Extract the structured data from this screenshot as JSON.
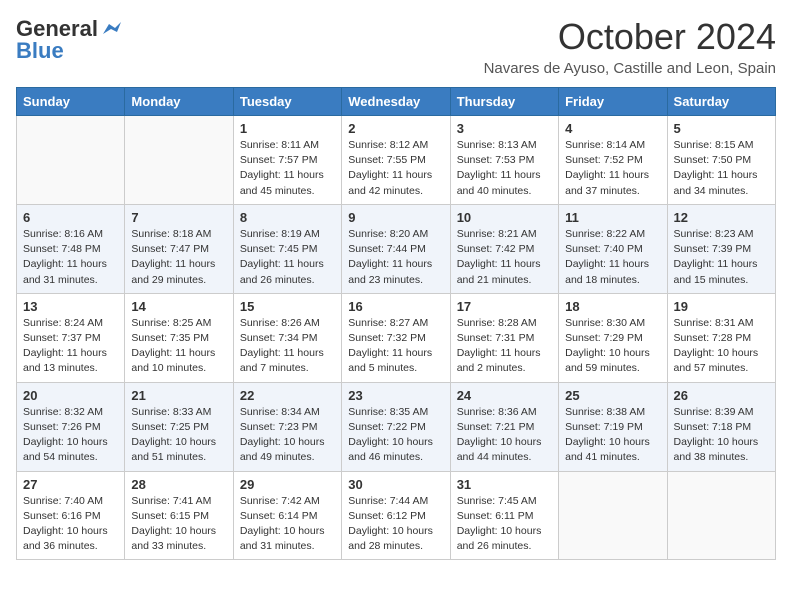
{
  "header": {
    "logo_general": "General",
    "logo_blue": "Blue",
    "month_title": "October 2024",
    "subtitle": "Navares de Ayuso, Castille and Leon, Spain"
  },
  "days_of_week": [
    "Sunday",
    "Monday",
    "Tuesday",
    "Wednesday",
    "Thursday",
    "Friday",
    "Saturday"
  ],
  "weeks": [
    [
      {
        "day": "",
        "info": ""
      },
      {
        "day": "",
        "info": ""
      },
      {
        "day": "1",
        "info": "Sunrise: 8:11 AM\nSunset: 7:57 PM\nDaylight: 11 hours and 45 minutes."
      },
      {
        "day": "2",
        "info": "Sunrise: 8:12 AM\nSunset: 7:55 PM\nDaylight: 11 hours and 42 minutes."
      },
      {
        "day": "3",
        "info": "Sunrise: 8:13 AM\nSunset: 7:53 PM\nDaylight: 11 hours and 40 minutes."
      },
      {
        "day": "4",
        "info": "Sunrise: 8:14 AM\nSunset: 7:52 PM\nDaylight: 11 hours and 37 minutes."
      },
      {
        "day": "5",
        "info": "Sunrise: 8:15 AM\nSunset: 7:50 PM\nDaylight: 11 hours and 34 minutes."
      }
    ],
    [
      {
        "day": "6",
        "info": "Sunrise: 8:16 AM\nSunset: 7:48 PM\nDaylight: 11 hours and 31 minutes."
      },
      {
        "day": "7",
        "info": "Sunrise: 8:18 AM\nSunset: 7:47 PM\nDaylight: 11 hours and 29 minutes."
      },
      {
        "day": "8",
        "info": "Sunrise: 8:19 AM\nSunset: 7:45 PM\nDaylight: 11 hours and 26 minutes."
      },
      {
        "day": "9",
        "info": "Sunrise: 8:20 AM\nSunset: 7:44 PM\nDaylight: 11 hours and 23 minutes."
      },
      {
        "day": "10",
        "info": "Sunrise: 8:21 AM\nSunset: 7:42 PM\nDaylight: 11 hours and 21 minutes."
      },
      {
        "day": "11",
        "info": "Sunrise: 8:22 AM\nSunset: 7:40 PM\nDaylight: 11 hours and 18 minutes."
      },
      {
        "day": "12",
        "info": "Sunrise: 8:23 AM\nSunset: 7:39 PM\nDaylight: 11 hours and 15 minutes."
      }
    ],
    [
      {
        "day": "13",
        "info": "Sunrise: 8:24 AM\nSunset: 7:37 PM\nDaylight: 11 hours and 13 minutes."
      },
      {
        "day": "14",
        "info": "Sunrise: 8:25 AM\nSunset: 7:35 PM\nDaylight: 11 hours and 10 minutes."
      },
      {
        "day": "15",
        "info": "Sunrise: 8:26 AM\nSunset: 7:34 PM\nDaylight: 11 hours and 7 minutes."
      },
      {
        "day": "16",
        "info": "Sunrise: 8:27 AM\nSunset: 7:32 PM\nDaylight: 11 hours and 5 minutes."
      },
      {
        "day": "17",
        "info": "Sunrise: 8:28 AM\nSunset: 7:31 PM\nDaylight: 11 hours and 2 minutes."
      },
      {
        "day": "18",
        "info": "Sunrise: 8:30 AM\nSunset: 7:29 PM\nDaylight: 10 hours and 59 minutes."
      },
      {
        "day": "19",
        "info": "Sunrise: 8:31 AM\nSunset: 7:28 PM\nDaylight: 10 hours and 57 minutes."
      }
    ],
    [
      {
        "day": "20",
        "info": "Sunrise: 8:32 AM\nSunset: 7:26 PM\nDaylight: 10 hours and 54 minutes."
      },
      {
        "day": "21",
        "info": "Sunrise: 8:33 AM\nSunset: 7:25 PM\nDaylight: 10 hours and 51 minutes."
      },
      {
        "day": "22",
        "info": "Sunrise: 8:34 AM\nSunset: 7:23 PM\nDaylight: 10 hours and 49 minutes."
      },
      {
        "day": "23",
        "info": "Sunrise: 8:35 AM\nSunset: 7:22 PM\nDaylight: 10 hours and 46 minutes."
      },
      {
        "day": "24",
        "info": "Sunrise: 8:36 AM\nSunset: 7:21 PM\nDaylight: 10 hours and 44 minutes."
      },
      {
        "day": "25",
        "info": "Sunrise: 8:38 AM\nSunset: 7:19 PM\nDaylight: 10 hours and 41 minutes."
      },
      {
        "day": "26",
        "info": "Sunrise: 8:39 AM\nSunset: 7:18 PM\nDaylight: 10 hours and 38 minutes."
      }
    ],
    [
      {
        "day": "27",
        "info": "Sunrise: 7:40 AM\nSunset: 6:16 PM\nDaylight: 10 hours and 36 minutes."
      },
      {
        "day": "28",
        "info": "Sunrise: 7:41 AM\nSunset: 6:15 PM\nDaylight: 10 hours and 33 minutes."
      },
      {
        "day": "29",
        "info": "Sunrise: 7:42 AM\nSunset: 6:14 PM\nDaylight: 10 hours and 31 minutes."
      },
      {
        "day": "30",
        "info": "Sunrise: 7:44 AM\nSunset: 6:12 PM\nDaylight: 10 hours and 28 minutes."
      },
      {
        "day": "31",
        "info": "Sunrise: 7:45 AM\nSunset: 6:11 PM\nDaylight: 10 hours and 26 minutes."
      },
      {
        "day": "",
        "info": ""
      },
      {
        "day": "",
        "info": ""
      }
    ]
  ]
}
